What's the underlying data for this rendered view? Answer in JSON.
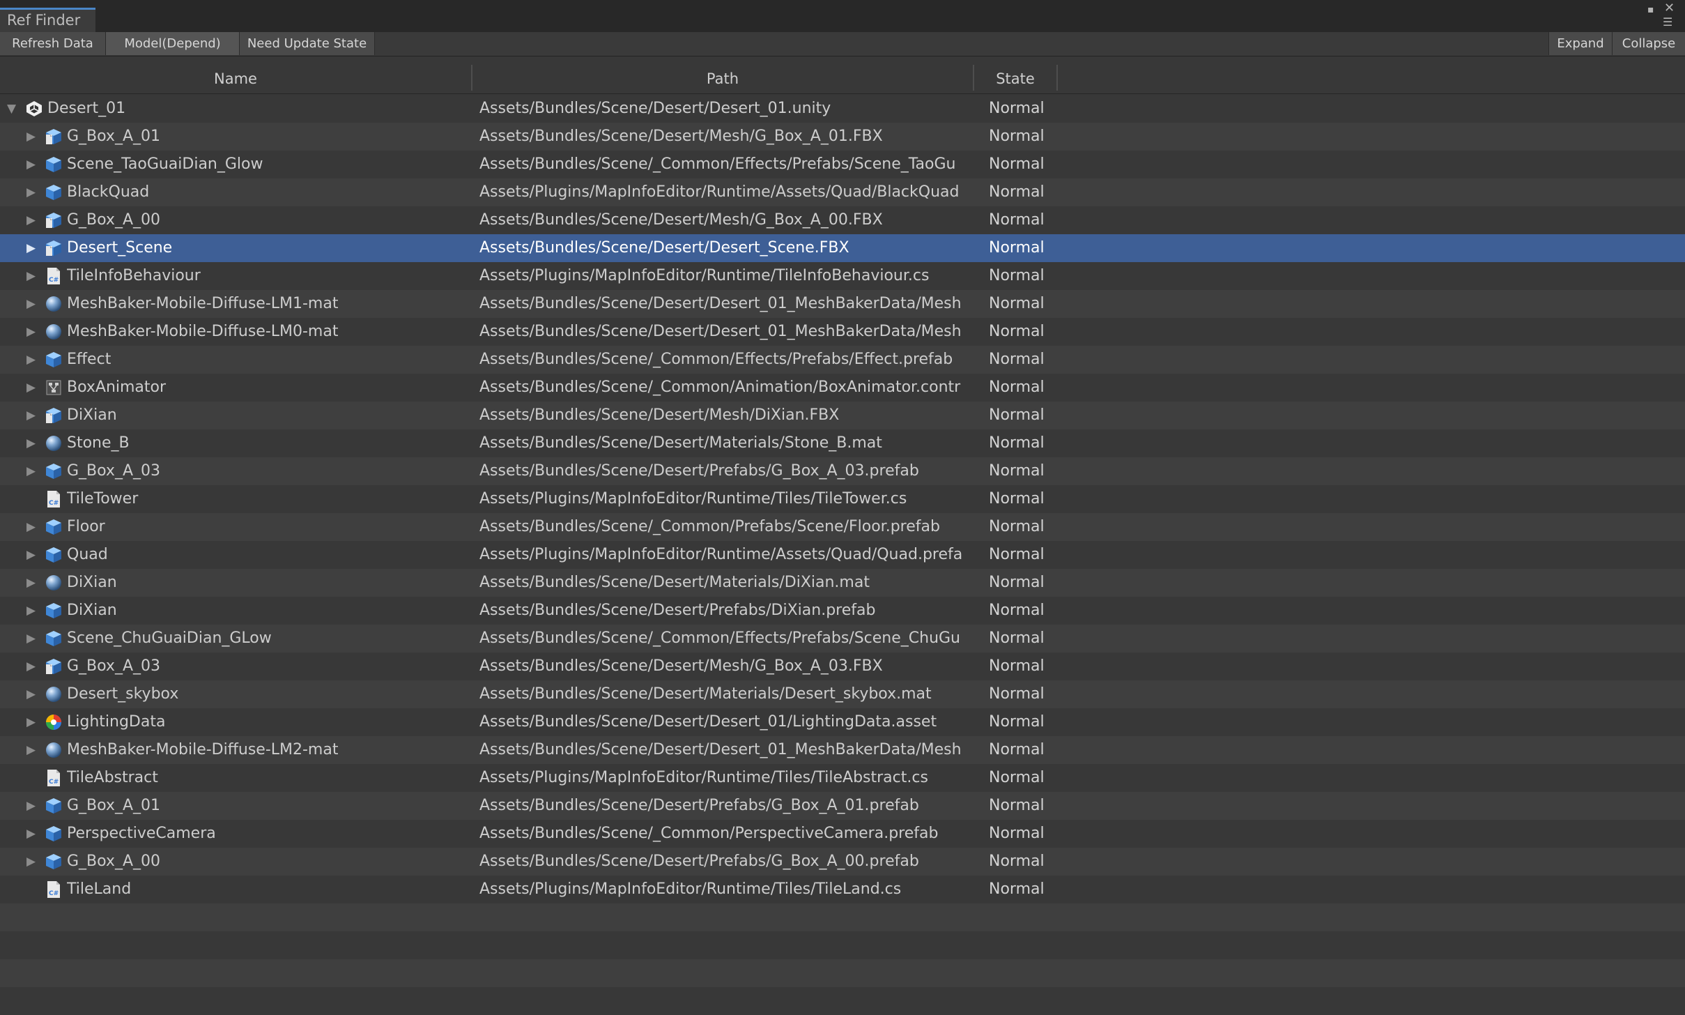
{
  "window": {
    "tab_title": "Ref Finder",
    "maximize_glyph": "▪",
    "close_glyph": "✕",
    "menu_glyph": "☰"
  },
  "toolbar": {
    "refresh_label": "Refresh Data",
    "mode_label": "Model(Depend)",
    "update_label": "Need Update State",
    "expand_label": "Expand",
    "collapse_label": "Collapse"
  },
  "columns": {
    "name": "Name",
    "path": "Path",
    "state": "State"
  },
  "icons": {
    "prefab": "prefab-cube-icon",
    "model": "model-file-icon",
    "material": "material-sphere-icon",
    "script": "csharp-script-icon",
    "animator": "animator-controller-icon",
    "lighting": "lighting-data-icon",
    "scene": "unity-scene-icon"
  },
  "colors": {
    "selection": "#3e5f96",
    "tab_accent": "#4a86c8",
    "background": "#383838"
  },
  "rows": [
    {
      "name": "Desert_01",
      "path": "Assets/Bundles/Scene/Desert/Desert_01.unity",
      "state": "Normal",
      "icon": "scene",
      "expander": "expanded",
      "root": true
    },
    {
      "name": "G_Box_A_01",
      "path": "Assets/Bundles/Scene/Desert/Mesh/G_Box_A_01.FBX",
      "state": "Normal",
      "icon": "model",
      "expander": "collapsed"
    },
    {
      "name": "Scene_TaoGuaiDian_Glow",
      "path": "Assets/Bundles/Scene/_Common/Effects/Prefabs/Scene_TaoGu",
      "state": "Normal",
      "icon": "prefab",
      "expander": "collapsed"
    },
    {
      "name": "BlackQuad",
      "path": "Assets/Plugins/MapInfoEditor/Runtime/Assets/Quad/BlackQuad",
      "state": "Normal",
      "icon": "prefab",
      "expander": "collapsed"
    },
    {
      "name": "G_Box_A_00",
      "path": "Assets/Bundles/Scene/Desert/Mesh/G_Box_A_00.FBX",
      "state": "Normal",
      "icon": "model",
      "expander": "collapsed"
    },
    {
      "name": "Desert_Scene",
      "path": "Assets/Bundles/Scene/Desert/Desert_Scene.FBX",
      "state": "Normal",
      "icon": "model",
      "expander": "collapsed",
      "selected": true
    },
    {
      "name": "TileInfoBehaviour",
      "path": "Assets/Plugins/MapInfoEditor/Runtime/TileInfoBehaviour.cs",
      "state": "Normal",
      "icon": "script",
      "expander": "collapsed"
    },
    {
      "name": "MeshBaker-Mobile-Diffuse-LM1-mat",
      "path": "Assets/Bundles/Scene/Desert/Desert_01_MeshBakerData/Mesh",
      "state": "Normal",
      "icon": "material",
      "expander": "collapsed"
    },
    {
      "name": "MeshBaker-Mobile-Diffuse-LM0-mat",
      "path": "Assets/Bundles/Scene/Desert/Desert_01_MeshBakerData/Mesh",
      "state": "Normal",
      "icon": "material",
      "expander": "collapsed"
    },
    {
      "name": "Effect",
      "path": "Assets/Bundles/Scene/_Common/Effects/Prefabs/Effect.prefab",
      "state": "Normal",
      "icon": "prefab",
      "expander": "collapsed"
    },
    {
      "name": "BoxAnimator",
      "path": "Assets/Bundles/Scene/_Common/Animation/BoxAnimator.contr",
      "state": "Normal",
      "icon": "animator",
      "expander": "collapsed"
    },
    {
      "name": "DiXian",
      "path": "Assets/Bundles/Scene/Desert/Mesh/DiXian.FBX",
      "state": "Normal",
      "icon": "model",
      "expander": "collapsed"
    },
    {
      "name": "Stone_B",
      "path": "Assets/Bundles/Scene/Desert/Materials/Stone_B.mat",
      "state": "Normal",
      "icon": "material",
      "expander": "collapsed"
    },
    {
      "name": "G_Box_A_03",
      "path": "Assets/Bundles/Scene/Desert/Prefabs/G_Box_A_03.prefab",
      "state": "Normal",
      "icon": "prefab",
      "expander": "collapsed"
    },
    {
      "name": "TileTower",
      "path": "Assets/Plugins/MapInfoEditor/Runtime/Tiles/TileTower.cs",
      "state": "Normal",
      "icon": "script",
      "expander": "none"
    },
    {
      "name": "Floor",
      "path": "Assets/Bundles/Scene/_Common/Prefabs/Scene/Floor.prefab",
      "state": "Normal",
      "icon": "prefab",
      "expander": "collapsed"
    },
    {
      "name": "Quad",
      "path": "Assets/Plugins/MapInfoEditor/Runtime/Assets/Quad/Quad.prefa",
      "state": "Normal",
      "icon": "prefab",
      "expander": "collapsed"
    },
    {
      "name": "DiXian",
      "path": "Assets/Bundles/Scene/Desert/Materials/DiXian.mat",
      "state": "Normal",
      "icon": "material",
      "expander": "collapsed"
    },
    {
      "name": "DiXian",
      "path": "Assets/Bundles/Scene/Desert/Prefabs/DiXian.prefab",
      "state": "Normal",
      "icon": "prefab",
      "expander": "collapsed"
    },
    {
      "name": "Scene_ChuGuaiDian_GLow",
      "path": "Assets/Bundles/Scene/_Common/Effects/Prefabs/Scene_ChuGu",
      "state": "Normal",
      "icon": "prefab",
      "expander": "collapsed"
    },
    {
      "name": "G_Box_A_03",
      "path": "Assets/Bundles/Scene/Desert/Mesh/G_Box_A_03.FBX",
      "state": "Normal",
      "icon": "model",
      "expander": "collapsed"
    },
    {
      "name": "Desert_skybox",
      "path": "Assets/Bundles/Scene/Desert/Materials/Desert_skybox.mat",
      "state": "Normal",
      "icon": "material",
      "expander": "collapsed"
    },
    {
      "name": "LightingData",
      "path": "Assets/Bundles/Scene/Desert/Desert_01/LightingData.asset",
      "state": "Normal",
      "icon": "lighting",
      "expander": "collapsed"
    },
    {
      "name": "MeshBaker-Mobile-Diffuse-LM2-mat",
      "path": "Assets/Bundles/Scene/Desert/Desert_01_MeshBakerData/Mesh",
      "state": "Normal",
      "icon": "material",
      "expander": "collapsed"
    },
    {
      "name": "TileAbstract",
      "path": "Assets/Plugins/MapInfoEditor/Runtime/Tiles/TileAbstract.cs",
      "state": "Normal",
      "icon": "script",
      "expander": "none"
    },
    {
      "name": "G_Box_A_01",
      "path": "Assets/Bundles/Scene/Desert/Prefabs/G_Box_A_01.prefab",
      "state": "Normal",
      "icon": "prefab",
      "expander": "collapsed"
    },
    {
      "name": "PerspectiveCamera",
      "path": "Assets/Bundles/Scene/_Common/PerspectiveCamera.prefab",
      "state": "Normal",
      "icon": "prefab",
      "expander": "collapsed"
    },
    {
      "name": "G_Box_A_00",
      "path": "Assets/Bundles/Scene/Desert/Prefabs/G_Box_A_00.prefab",
      "state": "Normal",
      "icon": "prefab",
      "expander": "collapsed"
    },
    {
      "name": "TileLand",
      "path": "Assets/Plugins/MapInfoEditor/Runtime/Tiles/TileLand.cs",
      "state": "Normal",
      "icon": "script",
      "expander": "none"
    }
  ]
}
